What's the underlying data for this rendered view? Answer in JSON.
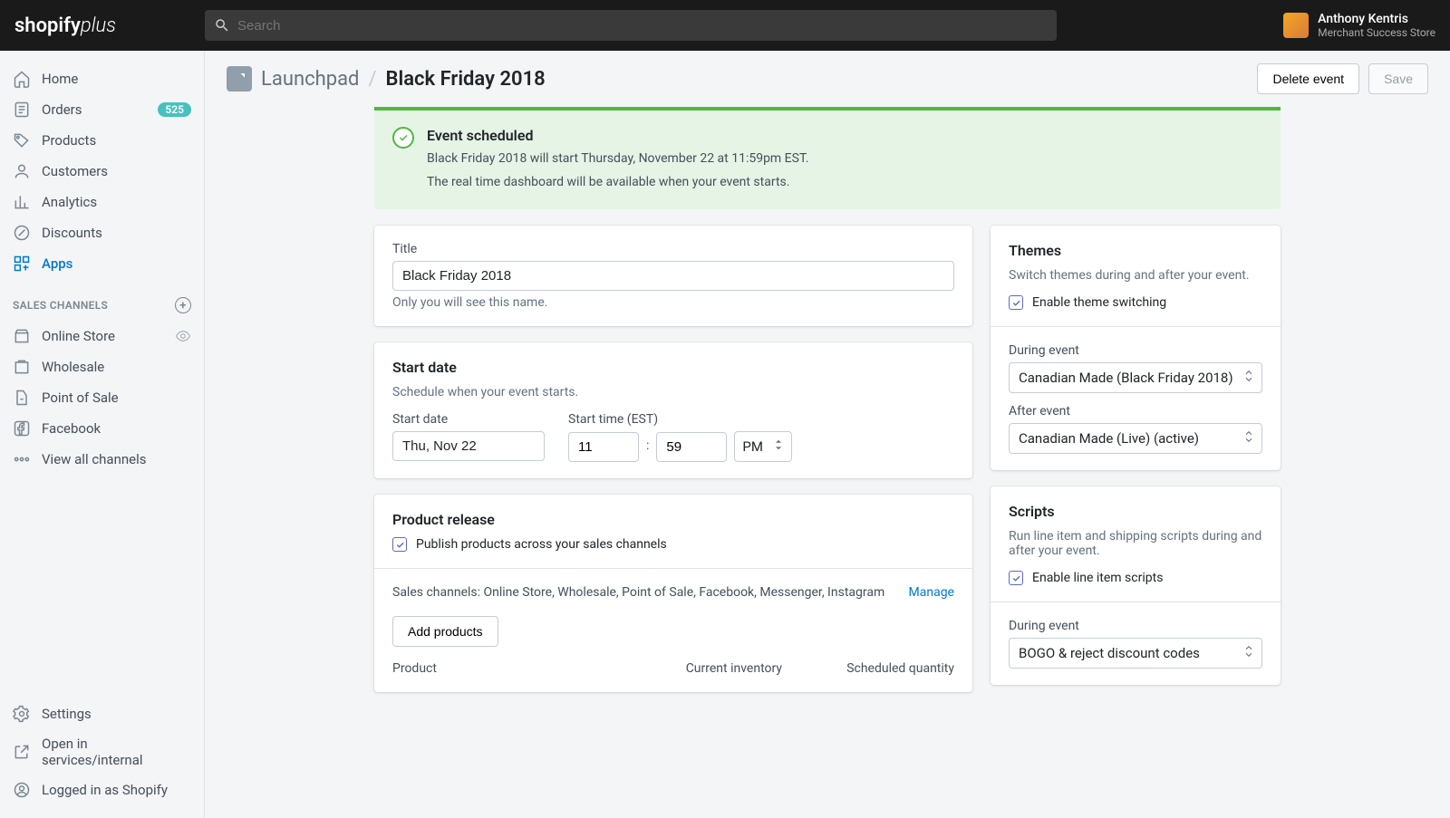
{
  "topbar": {
    "logo_main": "shopify",
    "logo_suffix": "plus",
    "search_placeholder": "Search"
  },
  "user": {
    "name": "Anthony Kentris",
    "store": "Merchant Success Store"
  },
  "sidebar": {
    "home": "Home",
    "orders": "Orders",
    "orders_badge": "525",
    "products": "Products",
    "customers": "Customers",
    "analytics": "Analytics",
    "discounts": "Discounts",
    "apps": "Apps",
    "sales_channels_title": "SALES CHANNELS",
    "online_store": "Online Store",
    "wholesale": "Wholesale",
    "pos": "Point of Sale",
    "facebook": "Facebook",
    "view_all": "View all channels",
    "settings": "Settings",
    "open_internal": "Open in services/internal",
    "logged_in_as": "Logged in as Shopify"
  },
  "header": {
    "breadcrumb_app": "Launchpad",
    "breadcrumb_sep": "/",
    "breadcrumb_current": "Black Friday 2018",
    "delete_label": "Delete event",
    "save_label": "Save"
  },
  "banner": {
    "title": "Event scheduled",
    "line1": "Black Friday 2018 will start Thursday, November 22 at 11:59pm EST.",
    "line2": "The real time dashboard will be available when your event starts."
  },
  "title_card": {
    "label": "Title",
    "value": "Black Friday 2018",
    "hint": "Only you will see this name."
  },
  "start_date": {
    "title": "Start date",
    "description": "Schedule when your event starts.",
    "date_label": "Start date",
    "date_value": "Thu, Nov 22",
    "time_label": "Start time (EST)",
    "hour_value": "11",
    "minute_value": "59",
    "ampm_value": "PM"
  },
  "product_release": {
    "title": "Product release",
    "checkbox_label": "Publish products across your sales channels",
    "channels_text": "Sales channels: Online Store, Wholesale, Point of Sale, Facebook, Messenger, Instagram",
    "manage_label": "Manage",
    "add_products_label": "Add products",
    "col_product": "Product",
    "col_inventory": "Current inventory",
    "col_scheduled": "Scheduled quantity"
  },
  "themes": {
    "title": "Themes",
    "description": "Switch themes during and after your event.",
    "checkbox_label": "Enable theme switching",
    "during_label": "During event",
    "during_value": "Canadian Made (Black Friday 2018)",
    "after_label": "After event",
    "after_value": "Canadian Made (Live) (active)"
  },
  "scripts": {
    "title": "Scripts",
    "description": "Run line item and shipping scripts during and after your event.",
    "checkbox_label": "Enable line item scripts",
    "during_label": "During event",
    "during_value": "BOGO & reject discount codes"
  }
}
